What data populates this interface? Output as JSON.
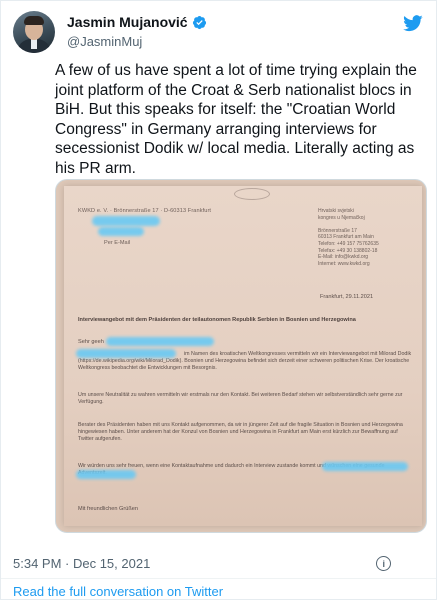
{
  "author": {
    "name": "Jasmin Mujanović",
    "handle": "@JasminMuj",
    "verified_color": "#1d9bf0",
    "avatar_icon": "profile-photo"
  },
  "tweet": {
    "text": "A few of us have spent a lot of time trying explain the joint platform of the Croat & Serb nationalist blocs in BiH. But this speaks for itself: the \"Croatian World Congress\" in Germany arranging interviews for secessionist Dodik w/ local media. Literally acting as his PR arm.",
    "timestamp": "5:34 PM · Dec 15, 2021",
    "read_more": "Read the full conversation on Twitter"
  },
  "document": {
    "sender_line": "KWKD e. V. · Brönnerstraße 17 · D-60313 Frankfurt",
    "per_email": "Per E-Mail",
    "address_lines": [
      "Hrvatski svjetski",
      "kongres u Njemačkoj",
      "",
      "Brönnerstraße 17",
      "60313 Frankfurt am Main",
      "Telefon: +49 157 75762635",
      "Telefax: +49 30 138802-18",
      "E-Mail: info@kwkd.org",
      "Internet: www.kwkd.org"
    ],
    "date": "Frankfurt, 29.11.2021",
    "subject": "Interviewangebot mit dem Präsidenten der teilautonomen Republik Serbien in Bosnien und Herzegowina",
    "salutation": "Sehr geeh",
    "paragraph_1": "im Namen des kroatischen Weltkongresses vermitteln wir ein Interviewangebot mit Milorad Dodik (https://de.wikipedia.org/wiki/Milorad_Dodik). Bosnien und Herzegowina befindet sich derzeit einer schweren politischen Krise. Der kroatische Weltkongress beobachtet die Entwicklungen mit Besorgnis.",
    "paragraph_2": "Um unsere Neutralität zu wahren vermitteln wir erstmals nur den Kontakt. Bei weiteren Bedarf stehen wir selbstverständlich sehr gerne zur Verfügung.",
    "paragraph_3": "Berater des Präsidenten haben mit uns Kontakt aufgenommen, da wir in jüngerer Zeit auf die fragile Situation in Bosnien und Herzegowina hingewiesen haben. Unter anderem hat der Konzul von Bosnien und Herzegowina in Frankfurt am Main erst kürzlich zur Bewaffnung auf Twitter aufgerufen.",
    "paragraph_4": "Wir würden uns sehr freuen, wenn eine Kontaktaufnahme und dadurch ein Interview zustande kommt und wünschen eine gesunde Adventszeit.",
    "closing": "Mit freundlichen Grüßen"
  }
}
